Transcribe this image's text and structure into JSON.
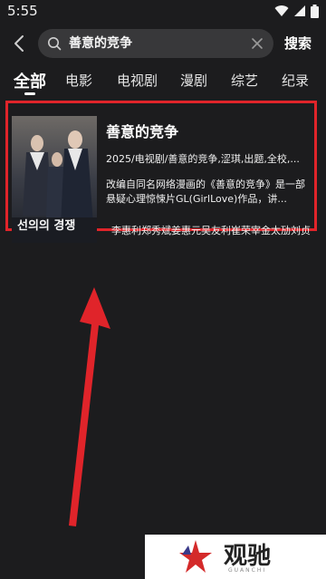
{
  "status_bar": {
    "time": "5:55",
    "icons": [
      "wifi-icon",
      "signal-icon",
      "battery-icon"
    ]
  },
  "search": {
    "query": "善意的竞争",
    "submit_label": "搜索"
  },
  "tabs": [
    {
      "label": "全部",
      "active": true
    },
    {
      "label": "电影",
      "active": false
    },
    {
      "label": "电视剧",
      "active": false
    },
    {
      "label": "漫剧",
      "active": false
    },
    {
      "label": "综艺",
      "active": false
    },
    {
      "label": "纪录",
      "active": false
    }
  ],
  "result": {
    "title": "善意的竞争",
    "meta": "2025/电视剧/善意的竞争,涩琪,出题,全校,...",
    "description": "改编自同名网络漫画的《善意的竞争》是一部悬疑心理惊悚片GL(GirlLove)作品，讲...",
    "cast": "李惠利郑秀斌姜惠元吴友利崔荣宰金太劢刘贞",
    "poster_text": "선의의 경쟁"
  },
  "watermark": {
    "brand": "观驰",
    "sub": "GUANCHI"
  },
  "colors": {
    "background": "#1c1c1e",
    "highlight_border": "#e0242a",
    "arrow": "#e0242a"
  }
}
